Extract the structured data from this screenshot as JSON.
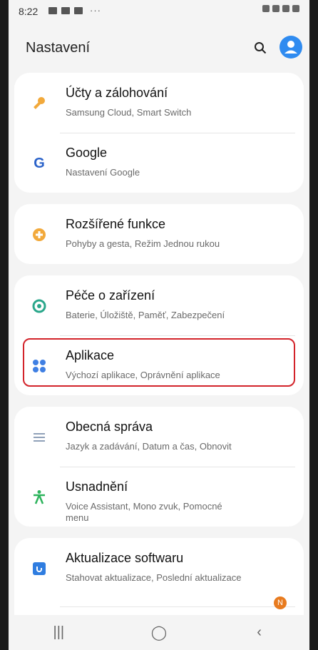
{
  "status": {
    "time": "8:22",
    "extra": "···"
  },
  "header": {
    "title": "Nastavení"
  },
  "cards": [
    {
      "items": [
        {
          "title": "Účty a zálohování",
          "subtitle": "Samsung Cloud, Smart Switch",
          "icon": "key-icon"
        },
        {
          "title": "Google",
          "subtitle": "Nastavení Google",
          "icon": "google-icon"
        }
      ]
    },
    {
      "items": [
        {
          "title": "Rozšířené funkce",
          "subtitle": "Pohyby a gesta, Režim Jednou rukou",
          "icon": "gear-plus-icon"
        }
      ]
    },
    {
      "items": [
        {
          "title": "Péče o zařízení",
          "subtitle": "Baterie, Úložiště, Paměť, Zabezpečení",
          "icon": "care-icon"
        },
        {
          "title": "Aplikace",
          "subtitle": "Výchozí aplikace, Oprávnění aplikace",
          "icon": "apps-icon"
        }
      ]
    },
    {
      "items": [
        {
          "title": "Obecná správa",
          "subtitle": "Jazyk a zadávání, Datum a čas, Obnovit",
          "icon": "sliders-icon"
        },
        {
          "title": "Usnadnění",
          "subtitle": "Voice Assistant, Mono zvuk, Pomocné menu",
          "icon": "accessibility-icon"
        }
      ]
    },
    {
      "items": [
        {
          "title": "Aktualizace softwaru",
          "subtitle": "Stahovat aktualizace, Poslední aktualizace",
          "icon": "update-icon"
        }
      ]
    }
  ],
  "badge": "N",
  "nav": {
    "recent": "|||",
    "home": "◯",
    "back": "‹"
  }
}
